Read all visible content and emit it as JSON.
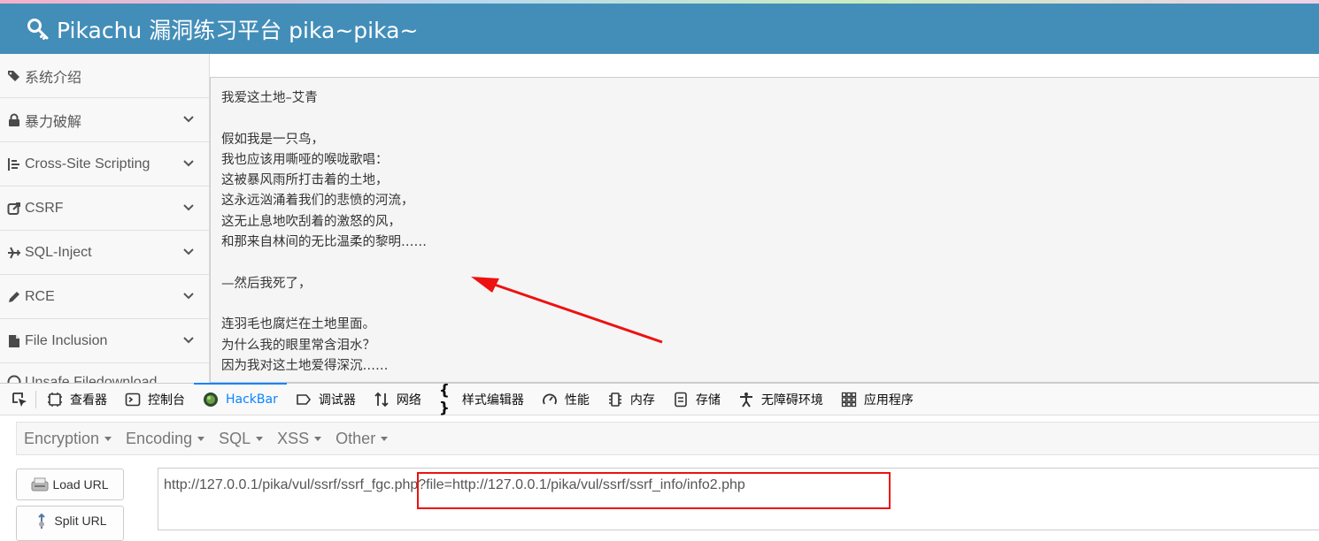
{
  "header": {
    "title": "Pikachu 漏洞练习平台 pika~pika~"
  },
  "sidebar": {
    "items": [
      {
        "label": "系统介绍",
        "icon": "tags-icon"
      },
      {
        "label": "暴力破解",
        "icon": "lock-icon"
      },
      {
        "label": "Cross-Site Scripting",
        "icon": "list-icon"
      },
      {
        "label": "CSRF",
        "icon": "share-icon"
      },
      {
        "label": "SQL-Inject",
        "icon": "plane-icon"
      },
      {
        "label": "RCE",
        "icon": "pencil-icon"
      },
      {
        "label": "File Inclusion",
        "icon": "file-icon"
      },
      {
        "label": "Unsafe Filedownload",
        "icon": "download-icon"
      }
    ]
  },
  "poem": {
    "text": "我爱这土地–艾青\n\n假如我是一只鸟，\n我也应该用嘶哑的喉咙歌唱：\n这被暴风雨所打击着的土地，\n这永远汹涌着我们的悲愤的河流，\n这无止息地吹刮着的激怒的风，\n和那来自林间的无比温柔的黎明……\n\n—然后我死了，\n\n连羽毛也腐烂在土地里面。\n为什么我的眼里常含泪水？\n因为我对这土地爱得深沉……"
  },
  "devtools": {
    "tabs": [
      {
        "label": "查看器",
        "icon": "inspector-icon"
      },
      {
        "label": "控制台",
        "icon": "console-icon"
      },
      {
        "label": "HackBar",
        "icon": "hackbar-icon",
        "active": true
      },
      {
        "label": "调试器",
        "icon": "debugger-icon"
      },
      {
        "label": "网络",
        "icon": "network-icon"
      },
      {
        "label": "样式编辑器",
        "icon": "style-editor-icon"
      },
      {
        "label": "性能",
        "icon": "performance-icon"
      },
      {
        "label": "内存",
        "icon": "memory-icon"
      },
      {
        "label": "存储",
        "icon": "storage-icon"
      },
      {
        "label": "无障碍环境",
        "icon": "accessibility-icon"
      },
      {
        "label": "应用程序",
        "icon": "application-icon"
      }
    ]
  },
  "hackbar": {
    "menu": [
      "Encryption",
      "Encoding",
      "SQL",
      "XSS",
      "Other"
    ],
    "load_url": "Load URL",
    "split_url": "Split URL",
    "url": "http://127.0.0.1/pika/vul/ssrf/ssrf_fgc.php?file=http://127.0.0.1/pika/vul/ssrf/ssrf_info/info2.php"
  },
  "colors": {
    "header": "#438eb9",
    "active_tab": "#0a84ff",
    "annotation": "#ee1111"
  }
}
